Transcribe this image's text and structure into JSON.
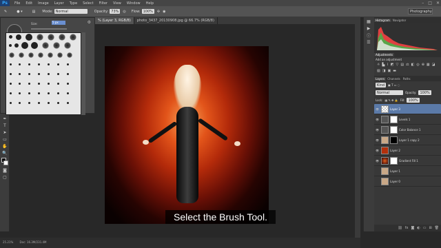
{
  "menu": {
    "logo": "Ps",
    "items": [
      "File",
      "Edit",
      "Image",
      "Layer",
      "Type",
      "Select",
      "Filter",
      "View",
      "Window",
      "Help"
    ]
  },
  "options": {
    "mode_label": "Mode:",
    "mode_value": "Normal",
    "opacity_label": "Opacity:",
    "opacity_value": "73%",
    "flow_label": "Flow:",
    "flow_value": "100%",
    "workspace": "Photography"
  },
  "brush_panel": {
    "size_label": "Size:",
    "size_value": "5 px",
    "hardness_label": "Hardness:",
    "hardness_value": "100%"
  },
  "tabs": [
    {
      "label": "% (Layer 3, RGB/8)",
      "active": true
    },
    {
      "label": "photo_3437_20130908.jpg @ 66.7% (RGB/8)",
      "active": false
    }
  ],
  "panels": {
    "histogram_tab": "Histogram",
    "navigator_tab": "Navigator",
    "adjustments_tab": "Adjustments",
    "add_adjustment": "Add an adjustment",
    "layers_tabs": [
      "Layers",
      "Channels",
      "Paths"
    ],
    "kind": "Kind",
    "blend": "Normal",
    "opacity_label": "Opacity:",
    "opacity_value": "100%",
    "lock_label": "Lock:",
    "fill_label": "Fill:",
    "fill_value": "100%",
    "layers": [
      {
        "name": "Layer 3",
        "selected": true
      },
      {
        "name": "Levels 1",
        "selected": false
      },
      {
        "name": "Color Balance 1",
        "selected": false
      },
      {
        "name": "Layer 1 copy 2",
        "selected": false
      },
      {
        "name": "Layer 2",
        "selected": false
      },
      {
        "name": "Gradient Fill 1",
        "selected": false
      },
      {
        "name": "Layer 1",
        "selected": false
      },
      {
        "name": "Layer 0",
        "selected": false
      }
    ]
  },
  "status": {
    "zoom": "25.21%",
    "doc": "Doc: 16.3M/231.4M"
  },
  "caption": "Select the Brush Tool."
}
